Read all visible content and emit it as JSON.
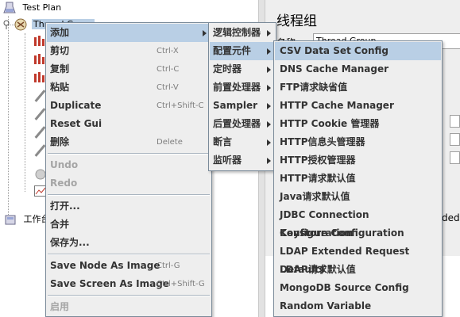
{
  "tree": {
    "test_plan_label": "Test Plan",
    "thread_group_label": "Thread Group",
    "workbench_label": "工作台"
  },
  "right_panel": {
    "title": "线程组",
    "name_label": "名称",
    "name_value": "Thread Group",
    "partial_text": "ded"
  },
  "context_menu": {
    "items": [
      {
        "label": "添加",
        "accel": "",
        "submenu": true,
        "selected": true,
        "disabled": false
      },
      {
        "label": "剪切",
        "accel": "Ctrl-X",
        "submenu": false,
        "selected": false,
        "disabled": false
      },
      {
        "label": "复制",
        "accel": "Ctrl-C",
        "submenu": false,
        "selected": false,
        "disabled": false
      },
      {
        "label": "粘贴",
        "accel": "Ctrl-V",
        "submenu": false,
        "selected": false,
        "disabled": false
      },
      {
        "label": "Duplicate",
        "accel": "Ctrl+Shift-C",
        "submenu": false,
        "selected": false,
        "disabled": false
      },
      {
        "label": "Reset Gui",
        "accel": "",
        "submenu": false,
        "selected": false,
        "disabled": false
      },
      {
        "label": "删除",
        "accel": "Delete",
        "submenu": false,
        "selected": false,
        "disabled": false
      },
      {
        "label": "Undo",
        "accel": "",
        "submenu": false,
        "selected": false,
        "disabled": true
      },
      {
        "label": "Redo",
        "accel": "",
        "submenu": false,
        "selected": false,
        "disabled": true
      },
      {
        "label": "打开...",
        "accel": "",
        "submenu": false,
        "selected": false,
        "disabled": false
      },
      {
        "label": "合并",
        "accel": "",
        "submenu": false,
        "selected": false,
        "disabled": false
      },
      {
        "label": "保存为...",
        "accel": "",
        "submenu": false,
        "selected": false,
        "disabled": false
      },
      {
        "label": "Save Node As Image",
        "accel": "Ctrl-G",
        "submenu": false,
        "selected": false,
        "disabled": false
      },
      {
        "label": "Save Screen As Image",
        "accel": "Ctrl+Shift-G",
        "submenu": false,
        "selected": false,
        "disabled": false
      },
      {
        "label": "启用",
        "accel": "",
        "submenu": false,
        "selected": false,
        "disabled": true
      }
    ]
  },
  "add_submenu": {
    "items": [
      {
        "label": "逻辑控制器",
        "selected": false
      },
      {
        "label": "配置元件",
        "selected": true
      },
      {
        "label": "定时器",
        "selected": false
      },
      {
        "label": "前置处理器",
        "selected": false
      },
      {
        "label": "Sampler",
        "selected": false
      },
      {
        "label": "后置处理器",
        "selected": false
      },
      {
        "label": "断言",
        "selected": false
      },
      {
        "label": "监听器",
        "selected": false
      }
    ]
  },
  "config_submenu": {
    "items": [
      {
        "label": "CSV Data Set Config",
        "selected": true
      },
      {
        "label": "DNS Cache Manager",
        "selected": false
      },
      {
        "label": "FTP请求缺省值",
        "selected": false
      },
      {
        "label": "HTTP Cache Manager",
        "selected": false
      },
      {
        "label": "HTTP Cookie 管理器",
        "selected": false
      },
      {
        "label": "HTTP信息头管理器",
        "selected": false
      },
      {
        "label": "HTTP授权管理器",
        "selected": false
      },
      {
        "label": "HTTP请求默认值",
        "selected": false
      },
      {
        "label": "Java请求默认值",
        "selected": false
      },
      {
        "label": "JDBC Connection Configuration",
        "selected": false
      },
      {
        "label": "Keystore Configuration",
        "selected": false
      },
      {
        "label": "LDAP Extended Request Defaults",
        "selected": false
      },
      {
        "label": "LDAP请求默认值",
        "selected": false
      },
      {
        "label": "MongoDB Source Config",
        "selected": false
      },
      {
        "label": "Random Variable",
        "selected": false
      }
    ]
  },
  "colors": {
    "selection": "#b9cfe5",
    "menu_bg": "#eeeeee",
    "disabled_text": "#a5a5a5"
  }
}
